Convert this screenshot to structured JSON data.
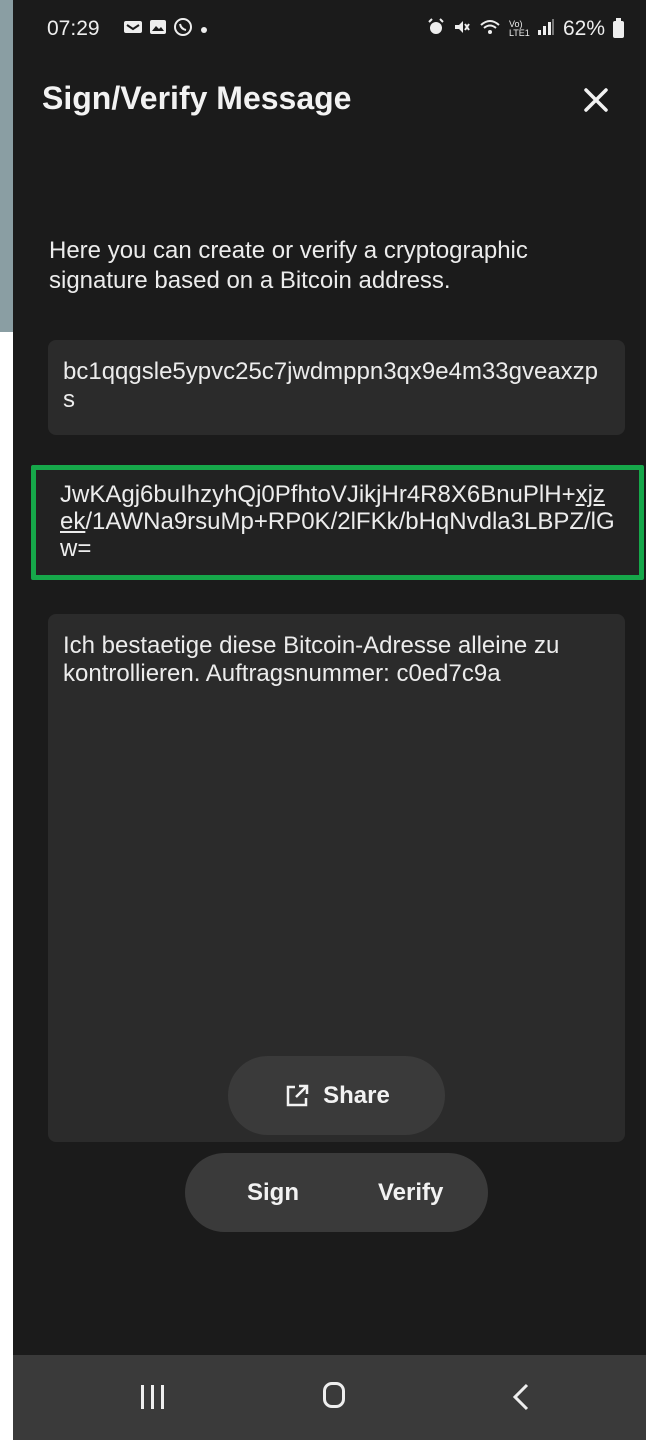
{
  "status_bar": {
    "time": "07:29",
    "notification_icons": [
      "phone-icon",
      "image-icon",
      "whatsapp-icon",
      "dot-icon"
    ],
    "system_icons": [
      "alarm-icon",
      "mute-icon",
      "wifi-icon",
      "signal-icon"
    ],
    "network_label": "Vo) LTE1",
    "battery_percent": "62%"
  },
  "header": {
    "title": "Sign/Verify Message",
    "close_icon": "close-icon"
  },
  "description": "Here you can create or verify a cryptographic signature based on a Bitcoin address.",
  "fields": {
    "address": "bc1qqgsle5ypvc25c7jwdmppn3qx9e4m33gveaxzps",
    "signature_before": "JwKAgj6buIhzyhQj0PfhtoVJikjHr4R8X6BnuPlH+",
    "signature_underlined": "xjzek",
    "signature_after": "/1AWNa9rsuMp+RP0K/2lFKk/bHqNvdla3LBPZ/lGw=",
    "message": "Ich bestaetige diese Bitcoin-Adresse alleine zu kontrollieren. Auftragsnummer: c0ed7c9a"
  },
  "buttons": {
    "share_label": "Share",
    "share_icon": "external-link-icon",
    "sign_label": "Sign",
    "verify_label": "Verify"
  },
  "colors": {
    "background": "#1b1b1b",
    "field_background": "#2b2b2b",
    "highlight_border": "#16a84a",
    "button_background": "#3a3a3a",
    "text": "#ececec"
  },
  "nav_bar": {
    "icons": [
      "recents-icon",
      "home-icon",
      "back-icon"
    ]
  }
}
